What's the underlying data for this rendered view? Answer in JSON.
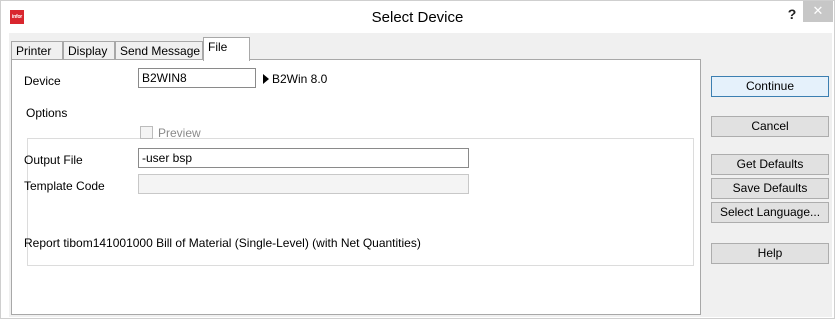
{
  "window": {
    "title": "Select Device",
    "logo_text": "infor",
    "help_symbol": "?",
    "close_symbol": "✕"
  },
  "tabs": [
    {
      "label": "Printer"
    },
    {
      "label": "Display"
    },
    {
      "label": "Send Message"
    },
    {
      "label": "File"
    }
  ],
  "form": {
    "device_label": "Device",
    "device_value": "B2WIN8",
    "device_description": "B2Win 8.0",
    "options_label": "Options",
    "preview_label": "Preview",
    "output_file_label": "Output File",
    "output_file_value": "-user bsp",
    "template_code_label": "Template Code",
    "template_code_value": "",
    "report_text": "Report tibom141001000 Bill of Material (Single-Level) (with Net Quantities)"
  },
  "buttons": {
    "continue": "Continue",
    "cancel": "Cancel",
    "get_defaults": "Get Defaults",
    "save_defaults": "Save Defaults",
    "select_language": "Select Language...",
    "help": "Help"
  }
}
